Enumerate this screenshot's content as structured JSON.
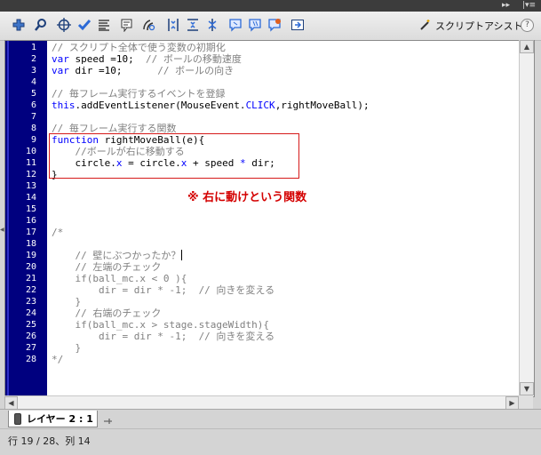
{
  "window": {
    "menu_glyph": "▸▸ | ▾≡"
  },
  "toolbar": {
    "icons": [
      "add-statement-icon",
      "find-icon",
      "target-path-icon",
      "check-syntax-icon",
      "auto-format-icon",
      "code-hint-icon",
      "debug-options-icon",
      "collapse-between-braces-icon",
      "collapse-selection-icon",
      "expand-all-icon",
      "apply-block-comment-icon",
      "apply-line-comment-icon",
      "remove-comment-icon",
      "show-hide-toolbox-icon"
    ],
    "script_assist_label": "スクリプトアシスト",
    "help_label": "?"
  },
  "editor": {
    "line_numbers": [
      "1",
      "2",
      "3",
      "4",
      "5",
      "6",
      "7",
      "8",
      "9",
      "10",
      "11",
      "12",
      "13",
      "14",
      "15",
      "16",
      "17",
      "18",
      "19",
      "20",
      "21",
      "22",
      "23",
      "24",
      "25",
      "26",
      "27",
      "28"
    ],
    "lines": [
      [
        {
          "t": "// スクリプト全体で使う変数の初期化",
          "c": "cm"
        }
      ],
      [
        {
          "t": "var",
          "c": "kw"
        },
        {
          "t": " speed =10;  ",
          "c": "tx"
        },
        {
          "t": "// ボールの移動速度",
          "c": "cm"
        }
      ],
      [
        {
          "t": "var",
          "c": "kw"
        },
        {
          "t": " dir =10;      ",
          "c": "tx"
        },
        {
          "t": "// ボールの向き",
          "c": "cm"
        }
      ],
      [],
      [
        {
          "t": "// 毎フレーム実行するイベントを登録",
          "c": "cm"
        }
      ],
      [
        {
          "t": "this",
          "c": "kw"
        },
        {
          "t": ".addEventListener(MouseEvent.",
          "c": "tx"
        },
        {
          "t": "CLICK",
          "c": "pr"
        },
        {
          "t": ",rightMoveBall);",
          "c": "tx"
        }
      ],
      [],
      [
        {
          "t": "// 毎フレーム実行する関数",
          "c": "cm"
        }
      ],
      [
        {
          "t": "function",
          "c": "kw"
        },
        {
          "t": " rightMoveBall(e){",
          "c": "tx"
        }
      ],
      [
        {
          "t": "    //ボールが右に移動する",
          "c": "cm"
        }
      ],
      [
        {
          "t": "    circle.",
          "c": "tx"
        },
        {
          "t": "x",
          "c": "pr"
        },
        {
          "t": " = circle.",
          "c": "tx"
        },
        {
          "t": "x",
          "c": "pr"
        },
        {
          "t": " + speed ",
          "c": "tx"
        },
        {
          "t": "*",
          "c": "pr"
        },
        {
          "t": " dir;",
          "c": "tx"
        }
      ],
      [
        {
          "t": "}",
          "c": "tx"
        }
      ],
      [],
      [],
      [],
      [],
      [
        {
          "t": "/*",
          "c": "cm"
        }
      ],
      [],
      [
        {
          "t": "    // 壁にぶつかったか？",
          "c": "cm"
        }
      ],
      [
        {
          "t": "    // 左端のチェック",
          "c": "cm"
        }
      ],
      [
        {
          "t": "    if(ball_mc.x < 0 ){",
          "c": "cm"
        }
      ],
      [
        {
          "t": "        dir = dir * -1;  // 向きを変える",
          "c": "cm"
        }
      ],
      [
        {
          "t": "    }",
          "c": "cm"
        }
      ],
      [
        {
          "t": "    // 右端のチェック",
          "c": "cm"
        }
      ],
      [
        {
          "t": "    if(ball_mc.x > stage.stageWidth){",
          "c": "cm"
        }
      ],
      [
        {
          "t": "        dir = dir * -1;  // 向きを変える",
          "c": "cm"
        }
      ],
      [
        {
          "t": "    }",
          "c": "cm"
        }
      ],
      [
        {
          "t": "*/",
          "c": "cm"
        }
      ]
    ]
  },
  "annotation": {
    "note": "※ 右に動けという関数"
  },
  "layer_tab": {
    "label": "レイヤー 2 : 1"
  },
  "status_bar": {
    "text": "行 19 / 28、列 14"
  }
}
